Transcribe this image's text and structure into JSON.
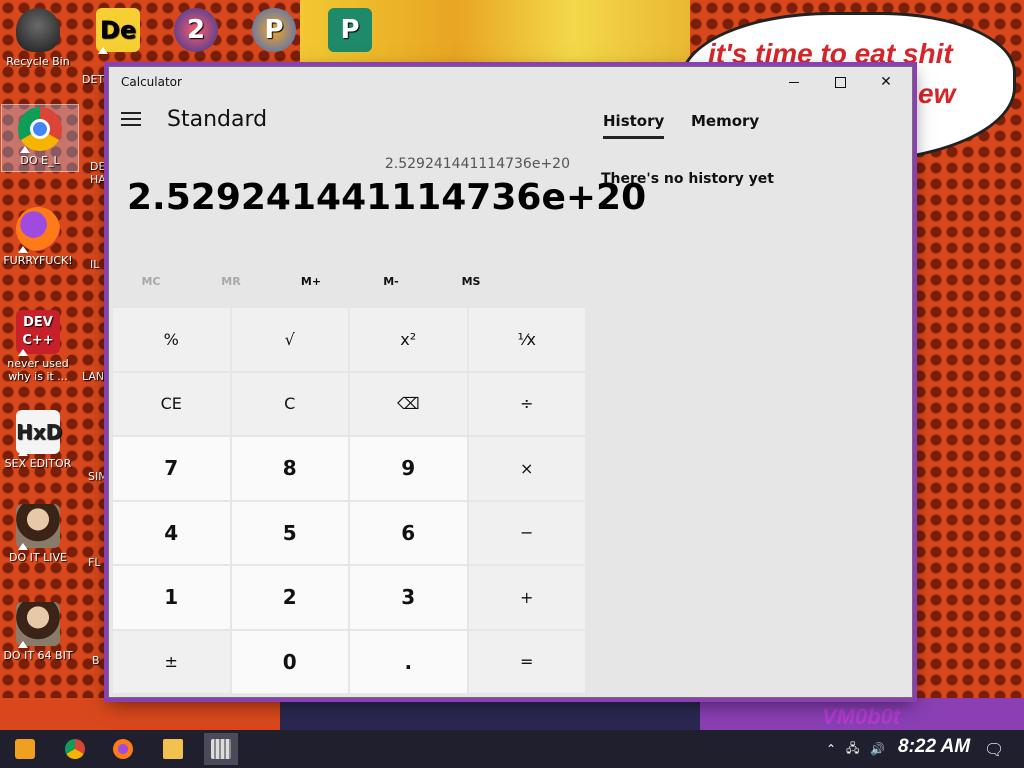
{
  "desktop": {
    "icons": [
      {
        "label": "Recycle Bin"
      },
      {
        "label": "DO E_L"
      },
      {
        "label": "FURRYFUCK!"
      },
      {
        "label": "never used why is it ..."
      },
      {
        "label": "SEX EDITOR"
      },
      {
        "label": "DO IT LIVE"
      },
      {
        "label": "DO IT 64 BIT"
      }
    ],
    "partial_labels": [
      "DET",
      "DE HA",
      "IL",
      "LAN",
      "SIM",
      "FL",
      "B"
    ],
    "bubble": {
      "line1": "it's time to eat shit",
      "line2": "ew"
    },
    "watermark": "VM0b0t"
  },
  "calculator": {
    "window_title": "Calculator",
    "mode": "Standard",
    "expression": "2.529241441114736e+20",
    "result": "2.529241441114736e+20",
    "memory_buttons": [
      {
        "label": "MC",
        "enabled": false
      },
      {
        "label": "MR",
        "enabled": false
      },
      {
        "label": "M+",
        "enabled": true
      },
      {
        "label": "M-",
        "enabled": true
      },
      {
        "label": "MS",
        "enabled": true
      }
    ],
    "keys": [
      {
        "label": "%",
        "kind": "op",
        "name": "percent"
      },
      {
        "label": "√",
        "kind": "op",
        "name": "square-root"
      },
      {
        "label": "x²",
        "kind": "op",
        "name": "square"
      },
      {
        "label": "¹⁄x",
        "kind": "op",
        "name": "reciprocal"
      },
      {
        "label": "CE",
        "kind": "op",
        "name": "clear-entry"
      },
      {
        "label": "C",
        "kind": "op",
        "name": "clear"
      },
      {
        "label": "⌫",
        "kind": "op",
        "name": "backspace"
      },
      {
        "label": "÷",
        "kind": "op",
        "name": "divide"
      },
      {
        "label": "7",
        "kind": "num",
        "name": "digit-7"
      },
      {
        "label": "8",
        "kind": "num",
        "name": "digit-8"
      },
      {
        "label": "9",
        "kind": "num",
        "name": "digit-9"
      },
      {
        "label": "×",
        "kind": "op",
        "name": "multiply"
      },
      {
        "label": "4",
        "kind": "num",
        "name": "digit-4"
      },
      {
        "label": "5",
        "kind": "num",
        "name": "digit-5"
      },
      {
        "label": "6",
        "kind": "num",
        "name": "digit-6"
      },
      {
        "label": "−",
        "kind": "op",
        "name": "subtract"
      },
      {
        "label": "1",
        "kind": "num",
        "name": "digit-1"
      },
      {
        "label": "2",
        "kind": "num",
        "name": "digit-2"
      },
      {
        "label": "3",
        "kind": "num",
        "name": "digit-3"
      },
      {
        "label": "+",
        "kind": "op",
        "name": "add"
      },
      {
        "label": "±",
        "kind": "op",
        "name": "negate"
      },
      {
        "label": "0",
        "kind": "num",
        "name": "digit-0"
      },
      {
        "label": ".",
        "kind": "num",
        "name": "decimal"
      },
      {
        "label": "=",
        "kind": "op",
        "name": "equals"
      }
    ],
    "tabs": {
      "history": "History",
      "memory": "Memory"
    },
    "history_empty": "There's no history yet"
  },
  "taskbar": {
    "clock": "8:22 AM",
    "apps": [
      {
        "name": "start",
        "color": "#f0a020"
      },
      {
        "name": "chrome",
        "color": "#e8453c"
      },
      {
        "name": "firefox",
        "color": "#ff7b18"
      },
      {
        "name": "file-explorer",
        "color": "#f2c14e"
      },
      {
        "name": "calculator",
        "color": "#8a8a8a"
      }
    ]
  }
}
